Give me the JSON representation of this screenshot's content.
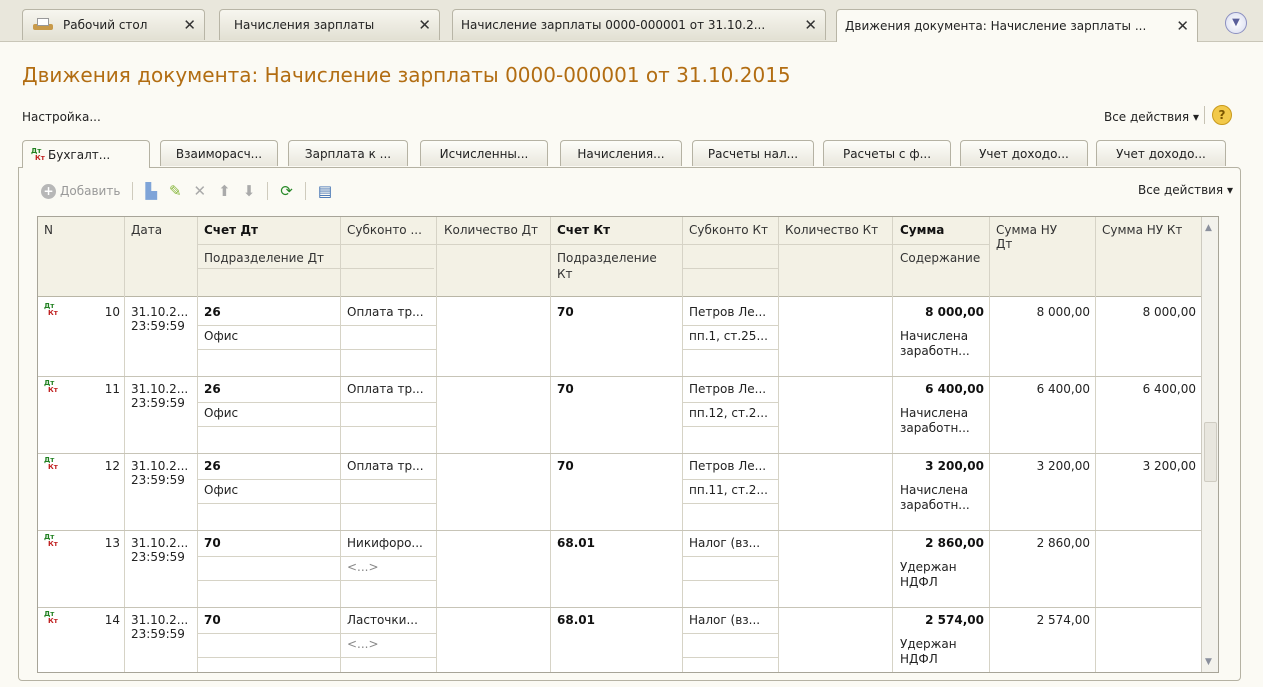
{
  "window_tabs": [
    {
      "label": "Рабочий стол",
      "close": "✕"
    },
    {
      "label": "Начисления зарплаты",
      "close": "✕"
    },
    {
      "label": "Начисление зарплаты 0000-000001 от 31.10.2...",
      "close": "✕"
    },
    {
      "label": "Движения документа: Начисление зарплаты ...",
      "close": "✕"
    }
  ],
  "page_title": "Движения документа: Начисление зарплаты 0000-000001 от 31.10.2015",
  "setup_link": "Настройка...",
  "all_actions": "Все действия ▾",
  "help": "?",
  "doc_tabs": [
    "Бухгалт...",
    "Взаиморасч...",
    "Зарплата к ...",
    "Исчисленны...",
    "Начисления...",
    "Расчеты нал...",
    "Расчеты с ф...",
    "Учет доходо...",
    "Учет доходо..."
  ],
  "toolbar": {
    "add_label": "Добавить",
    "all_actions": "Все действия ▾"
  },
  "columns": {
    "n": "N",
    "date": "Дата",
    "account_dt": "Счет Дт",
    "dept_dt": "Подразделение Дт",
    "subconto_dt": "Субконто ...",
    "qty_dt": "Количество Дт",
    "account_kt": "Счет Кт",
    "dept_kt_1": "Подразделение",
    "dept_kt_2": "Кт",
    "subconto_kt": "Субконто Кт",
    "qty_kt": "Количество Кт",
    "sum": "Сумма",
    "content": "Содержание",
    "sum_nu_dt_1": "Сумма НУ",
    "sum_nu_dt_2": "Дт",
    "sum_nu_kt": "Сумма НУ Кт"
  },
  "rows": [
    {
      "n": "10",
      "date": "31.10.2...",
      "time": "23:59:59",
      "acc_dt": "26",
      "dept_dt": "Офис",
      "sub_dt1": "Оплата тр...",
      "sub_dt2": "",
      "acc_kt": "70",
      "sub_kt1": "Петров Ле...",
      "sub_kt2": "пп.1, ст.25...",
      "sum": "8 000,00",
      "content1": "Начислена",
      "content2": "заработн...",
      "nu_dt": "8 000,00",
      "nu_kt": "8 000,00"
    },
    {
      "n": "11",
      "date": "31.10.2...",
      "time": "23:59:59",
      "acc_dt": "26",
      "dept_dt": "Офис",
      "sub_dt1": "Оплата тр...",
      "sub_dt2": "",
      "acc_kt": "70",
      "sub_kt1": "Петров Ле...",
      "sub_kt2": "пп.12, ст.2...",
      "sum": "6 400,00",
      "content1": "Начислена",
      "content2": "заработн...",
      "nu_dt": "6 400,00",
      "nu_kt": "6 400,00"
    },
    {
      "n": "12",
      "date": "31.10.2...",
      "time": "23:59:59",
      "acc_dt": "26",
      "dept_dt": "Офис",
      "sub_dt1": "Оплата тр...",
      "sub_dt2": "",
      "acc_kt": "70",
      "sub_kt1": "Петров Ле...",
      "sub_kt2": "пп.11, ст.2...",
      "sum": "3 200,00",
      "content1": "Начислена",
      "content2": "заработн...",
      "nu_dt": "3 200,00",
      "nu_kt": "3 200,00"
    },
    {
      "n": "13",
      "date": "31.10.2...",
      "time": "23:59:59",
      "acc_dt": "70",
      "dept_dt": "",
      "sub_dt1": "Никифоро...",
      "sub_dt2": "<...>",
      "acc_kt": "68.01",
      "sub_kt1": "Налог (вз...",
      "sub_kt2": "",
      "sum": "2 860,00",
      "content1": "Удержан",
      "content2": "НДФЛ",
      "nu_dt": "2 860,00",
      "nu_kt": ""
    },
    {
      "n": "14",
      "date": "31.10.2...",
      "time": "23:59:59",
      "acc_dt": "70",
      "dept_dt": "",
      "sub_dt1": "Ласточки...",
      "sub_dt2": "<...>",
      "acc_kt": "68.01",
      "sub_kt1": "Налог (вз...",
      "sub_kt2": "",
      "sum": "2 574,00",
      "content1": "Удержан",
      "content2": "НДФЛ",
      "nu_dt": "2 574,00",
      "nu_kt": ""
    }
  ]
}
